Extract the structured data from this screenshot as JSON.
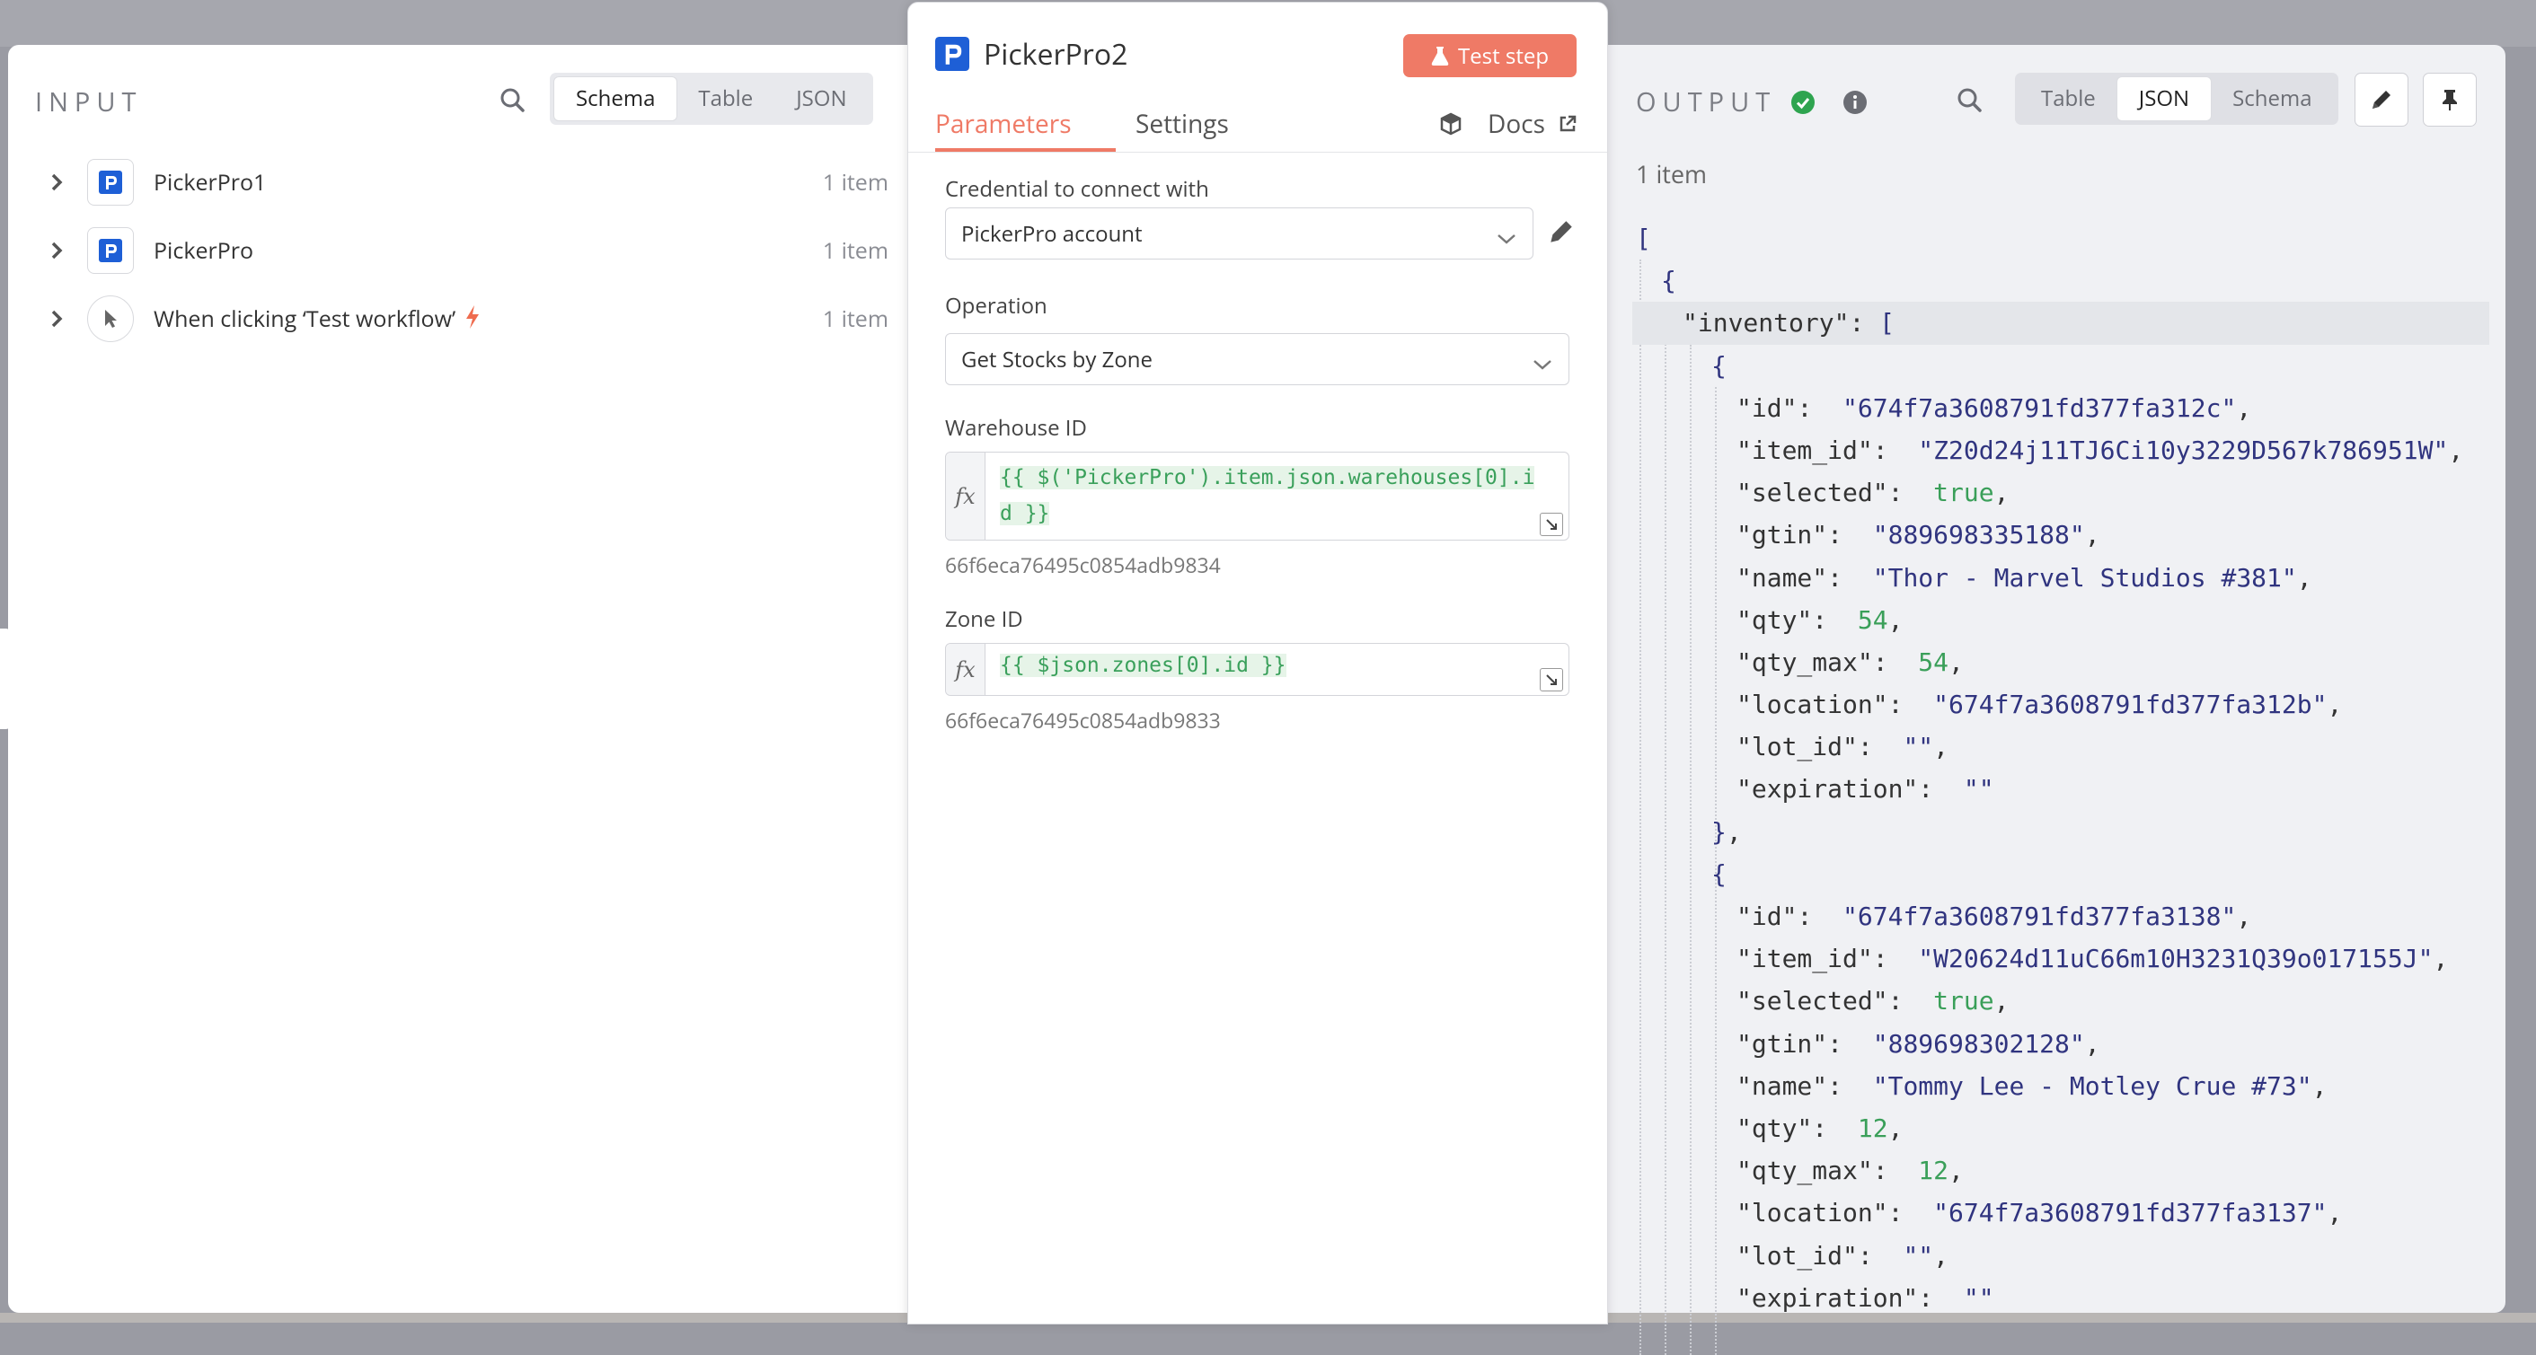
{
  "input": {
    "title": "INPUT",
    "view_tabs": [
      "Schema",
      "Table",
      "JSON"
    ],
    "active_view": "Schema",
    "nodes": [
      {
        "label": "PickerPro1",
        "count": "1 item",
        "icon": "pickerpro-logo-icon"
      },
      {
        "label": "PickerPro",
        "count": "1 item",
        "icon": "pickerpro-logo-icon"
      },
      {
        "label": "When clicking ‘Test workflow’",
        "count": "1 item",
        "icon": "pointer-icon",
        "badge": "bolt-icon"
      }
    ]
  },
  "node": {
    "title": "PickerPro2",
    "test_button": "Test step",
    "tabs": [
      "Parameters",
      "Settings"
    ],
    "active_tab": "Parameters",
    "docs_label": "Docs",
    "credential_label": "Credential to connect with",
    "credential_value": "PickerPro account",
    "operation_label": "Operation",
    "operation_value": "Get Stocks by Zone",
    "warehouse_label": "Warehouse ID",
    "warehouse_expr": "{{ $('PickerPro').item.json.warehouses[0].id }}",
    "warehouse_hint": "66f6eca76495c0854adb9834",
    "zone_label": "Zone ID",
    "zone_expr": "{{ $json.zones[0].id }}",
    "zone_hint": "66f6eca76495c0854adb9833",
    "fx_label": "fx"
  },
  "output": {
    "title": "OUTPUT",
    "status": "success",
    "view_tabs": [
      "Table",
      "JSON",
      "Schema"
    ],
    "active_view": "JSON",
    "count": "1 item",
    "json_lines": [
      {
        "indent": 0,
        "parts": [
          [
            "p",
            "["
          ]
        ]
      },
      {
        "indent": 1,
        "parts": [
          [
            "p",
            "{"
          ]
        ]
      },
      {
        "indent": 2,
        "parts": [
          [
            "k",
            "\"inventory\""
          ],
          [
            "k",
            ": "
          ],
          [
            "p",
            "["
          ]
        ],
        "hl": true
      },
      {
        "indent": 3,
        "parts": [
          [
            "p",
            "{"
          ]
        ]
      },
      {
        "indent": 4,
        "parts": [
          [
            "k",
            "\"id\""
          ],
          [
            "k",
            ":  "
          ],
          [
            "s",
            "\"674f7a3608791fd377fa312c\""
          ],
          [
            "k",
            ","
          ]
        ]
      },
      {
        "indent": 4,
        "parts": [
          [
            "k",
            "\"item_id\""
          ],
          [
            "k",
            ":  "
          ],
          [
            "s",
            "\"Z20d24j11TJ6Ci10y3229D567k786951W\""
          ],
          [
            "k",
            ","
          ]
        ]
      },
      {
        "indent": 4,
        "parts": [
          [
            "k",
            "\"selected\""
          ],
          [
            "k",
            ":  "
          ],
          [
            "b",
            "true"
          ],
          [
            "k",
            ","
          ]
        ]
      },
      {
        "indent": 4,
        "parts": [
          [
            "k",
            "\"gtin\""
          ],
          [
            "k",
            ":  "
          ],
          [
            "s",
            "\"889698335188\""
          ],
          [
            "k",
            ","
          ]
        ]
      },
      {
        "indent": 4,
        "parts": [
          [
            "k",
            "\"name\""
          ],
          [
            "k",
            ":  "
          ],
          [
            "s",
            "\"Thor - Marvel Studios #381\""
          ],
          [
            "k",
            ","
          ]
        ]
      },
      {
        "indent": 4,
        "parts": [
          [
            "k",
            "\"qty\""
          ],
          [
            "k",
            ":  "
          ],
          [
            "n",
            "54"
          ],
          [
            "k",
            ","
          ]
        ]
      },
      {
        "indent": 4,
        "parts": [
          [
            "k",
            "\"qty_max\""
          ],
          [
            "k",
            ":  "
          ],
          [
            "n",
            "54"
          ],
          [
            "k",
            ","
          ]
        ]
      },
      {
        "indent": 4,
        "parts": [
          [
            "k",
            "\"location\""
          ],
          [
            "k",
            ":  "
          ],
          [
            "s",
            "\"674f7a3608791fd377fa312b\""
          ],
          [
            "k",
            ","
          ]
        ]
      },
      {
        "indent": 4,
        "parts": [
          [
            "k",
            "\"lot_id\""
          ],
          [
            "k",
            ":  "
          ],
          [
            "s",
            "\"\""
          ],
          [
            "k",
            ","
          ]
        ]
      },
      {
        "indent": 4,
        "parts": [
          [
            "k",
            "\"expiration\""
          ],
          [
            "k",
            ":  "
          ],
          [
            "s",
            "\"\""
          ]
        ]
      },
      {
        "indent": 3,
        "parts": [
          [
            "p",
            "}"
          ],
          [
            "k",
            ","
          ]
        ]
      },
      {
        "indent": 3,
        "parts": [
          [
            "p",
            "{"
          ]
        ]
      },
      {
        "indent": 4,
        "parts": [
          [
            "k",
            "\"id\""
          ],
          [
            "k",
            ":  "
          ],
          [
            "s",
            "\"674f7a3608791fd377fa3138\""
          ],
          [
            "k",
            ","
          ]
        ]
      },
      {
        "indent": 4,
        "parts": [
          [
            "k",
            "\"item_id\""
          ],
          [
            "k",
            ":  "
          ],
          [
            "s",
            "\"W20624d11uC66m10H3231Q39o017155J\""
          ],
          [
            "k",
            ","
          ]
        ]
      },
      {
        "indent": 4,
        "parts": [
          [
            "k",
            "\"selected\""
          ],
          [
            "k",
            ":  "
          ],
          [
            "b",
            "true"
          ],
          [
            "k",
            ","
          ]
        ]
      },
      {
        "indent": 4,
        "parts": [
          [
            "k",
            "\"gtin\""
          ],
          [
            "k",
            ":  "
          ],
          [
            "s",
            "\"889698302128\""
          ],
          [
            "k",
            ","
          ]
        ]
      },
      {
        "indent": 4,
        "parts": [
          [
            "k",
            "\"name\""
          ],
          [
            "k",
            ":  "
          ],
          [
            "s",
            "\"Tommy Lee - Motley Crue #73\""
          ],
          [
            "k",
            ","
          ]
        ]
      },
      {
        "indent": 4,
        "parts": [
          [
            "k",
            "\"qty\""
          ],
          [
            "k",
            ":  "
          ],
          [
            "n",
            "12"
          ],
          [
            "k",
            ","
          ]
        ]
      },
      {
        "indent": 4,
        "parts": [
          [
            "k",
            "\"qty_max\""
          ],
          [
            "k",
            ":  "
          ],
          [
            "n",
            "12"
          ],
          [
            "k",
            ","
          ]
        ]
      },
      {
        "indent": 4,
        "parts": [
          [
            "k",
            "\"location\""
          ],
          [
            "k",
            ":  "
          ],
          [
            "s",
            "\"674f7a3608791fd377fa3137\""
          ],
          [
            "k",
            ","
          ]
        ]
      },
      {
        "indent": 4,
        "parts": [
          [
            "k",
            "\"lot_id\""
          ],
          [
            "k",
            ":  "
          ],
          [
            "s",
            "\"\""
          ],
          [
            "k",
            ","
          ]
        ]
      },
      {
        "indent": 4,
        "parts": [
          [
            "k",
            "\"expiration\""
          ],
          [
            "k",
            ":  "
          ],
          [
            "s",
            "\"\""
          ]
        ]
      }
    ]
  },
  "colors": {
    "accent": "#ef7a66",
    "brand": "#1e5fd6",
    "success": "#2ea44f",
    "json_string": "#30347f",
    "json_value": "#3a9f59"
  }
}
